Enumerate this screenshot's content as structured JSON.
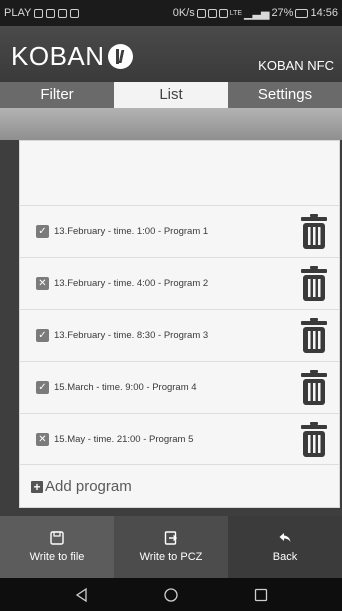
{
  "status_bar": {
    "carrier": "PLAY",
    "network_speed": "0K/s",
    "signal": "LTE",
    "battery": "27%",
    "time": "14:56"
  },
  "header": {
    "brand": "KOBAN",
    "device_label": "KOBAN NFC"
  },
  "tabs": [
    {
      "label": "Filter",
      "active": false
    },
    {
      "label": "List",
      "active": true
    },
    {
      "label": "Settings",
      "active": false
    }
  ],
  "programs": [
    {
      "checked": true,
      "label": "13.February - time. 1:00 - Program 1"
    },
    {
      "checked": false,
      "label": "13.February - time. 4:00 - Program 2"
    },
    {
      "checked": true,
      "label": "13.February - time. 8:30 - Program 3"
    },
    {
      "checked": true,
      "label": "15.March - time. 9:00 - Program 4"
    },
    {
      "checked": false,
      "label": "15.May - time. 21:00 - Program 5"
    }
  ],
  "add_program_label": "Add program",
  "bottom_actions": [
    {
      "label": "Write to file",
      "icon": "save-icon"
    },
    {
      "label": "Write to PCZ",
      "icon": "export-icon"
    },
    {
      "label": "Back",
      "icon": "back-arrow-icon"
    }
  ],
  "colors": {
    "header_bg": "#444444",
    "active_tab_bg": "#f3f3f3",
    "card_bg": "#f6f6f6",
    "checkbox": "#7b7b7b"
  }
}
